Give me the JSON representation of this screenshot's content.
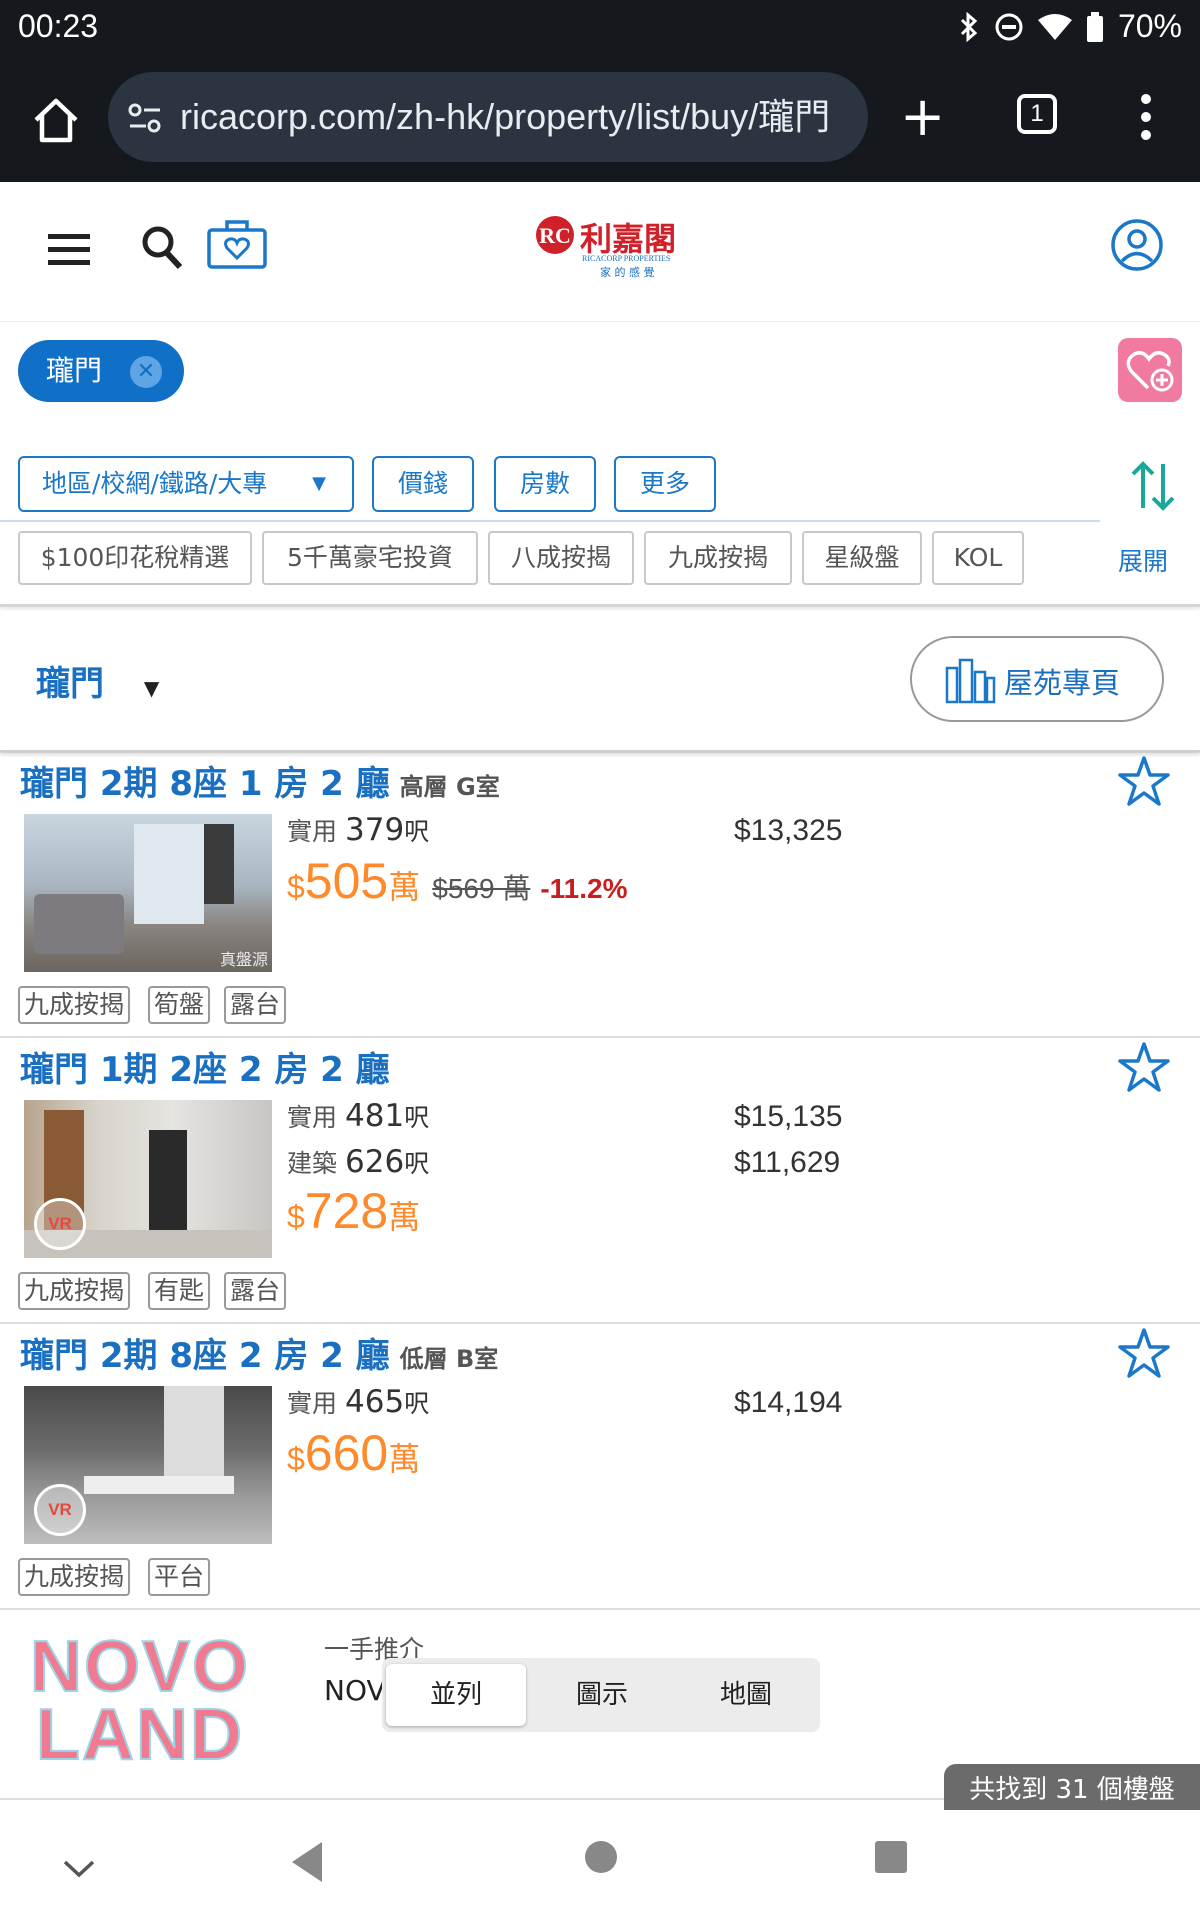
{
  "status": {
    "time": "00:23",
    "battery": "70%"
  },
  "browser": {
    "url": "ricacorp.com/zh-hk/property/list/buy/瓏門",
    "tab_count": "1"
  },
  "header": {
    "logo_text": "利嘉閣",
    "logo_sub": "RICACORP PROPERTIES",
    "logo_tag": "家 的 感 覺"
  },
  "filters": {
    "location_chip": "瓏門",
    "dropdowns": [
      "地區/校網/鐵路/大專",
      "價錢",
      "房數",
      "更多"
    ],
    "quick": [
      "$100印花稅精選",
      "5千萬豪宅投資",
      "八成按揭",
      "九成按揭",
      "星級盤",
      "KOL"
    ],
    "expand_label": "展開"
  },
  "estate": {
    "name": "瓏門",
    "page_button": "屋苑專頁"
  },
  "listings": [
    {
      "title": "瓏門 2期 8座 1 房 2 廳",
      "sub": "高層 G室",
      "specs": [
        {
          "k": "實用",
          "v": "379",
          "u": "呎",
          "ppsf": "$13,325"
        }
      ],
      "price_sym": "$",
      "price": "505",
      "price_unit": "萬",
      "old_price": "$569 萬",
      "pct": "-11.2%",
      "tags": [
        "九成按揭",
        "筍盤",
        "露台"
      ],
      "badge": "真盤源"
    },
    {
      "title": "瓏門 1期 2座 2 房 2 廳",
      "sub": "",
      "specs": [
        {
          "k": "實用",
          "v": "481",
          "u": "呎",
          "ppsf": "$15,135"
        },
        {
          "k": "建築",
          "v": "626",
          "u": "呎",
          "ppsf": "$11,629"
        }
      ],
      "price_sym": "$",
      "price": "728",
      "price_unit": "萬",
      "tags": [
        "九成按揭",
        "有匙",
        "露台"
      ],
      "badge": "VR"
    },
    {
      "title": "瓏門 2期 8座 2 房 2 廳",
      "sub": "低層 B室",
      "specs": [
        {
          "k": "實用",
          "v": "465",
          "u": "呎",
          "ppsf": "$14,194"
        }
      ],
      "price_sym": "$",
      "price": "660",
      "price_unit": "萬",
      "tags": [
        "九成按揭",
        "平台"
      ],
      "badge": "VR"
    }
  ],
  "promo": {
    "logo_line1": "NOVO",
    "logo_line2": "LAND",
    "heading": "一手推介",
    "name": "NOV"
  },
  "view_toggle": [
    "並列",
    "圖示",
    "地圖"
  ],
  "result_count": "共找到 31 個樓盤",
  "colors": {
    "accent": "#1b78c8",
    "price": "#ff8a2b",
    "discount": "#c71e1e",
    "brand_red": "#d0202a"
  }
}
